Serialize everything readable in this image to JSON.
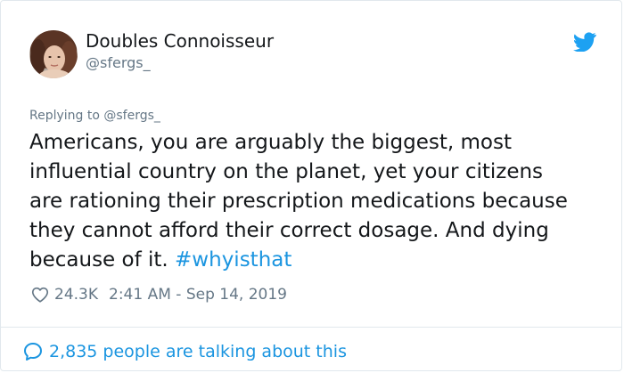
{
  "author": {
    "name": "Doubles Connoisseur",
    "handle": "@sfergs_"
  },
  "reply": {
    "prefix": "Replying to",
    "to": "@sfergs_"
  },
  "tweet": {
    "lines": [
      "Americans, you are arguably the biggest, most",
      "influential country on the planet, yet your citizens",
      "are rationing their prescription medications because",
      "they cannot afford their correct dosage. And dying"
    ],
    "last_line_text": "because of it.",
    "hashtag": "#whyisthat"
  },
  "stats": {
    "likes": "24.3K",
    "timestamp": "2:41 AM - Sep 14, 2019"
  },
  "footer": {
    "talking": "2,835 people are talking about this"
  },
  "icons": {
    "logo": "twitter-bird-icon",
    "like": "heart-icon",
    "talking": "speech-bubble-icon"
  },
  "colors": {
    "accent": "#1b95e0",
    "text": "#14171a",
    "muted": "#657786",
    "border": "#e1e8ed",
    "logo": "#1da1f2"
  }
}
